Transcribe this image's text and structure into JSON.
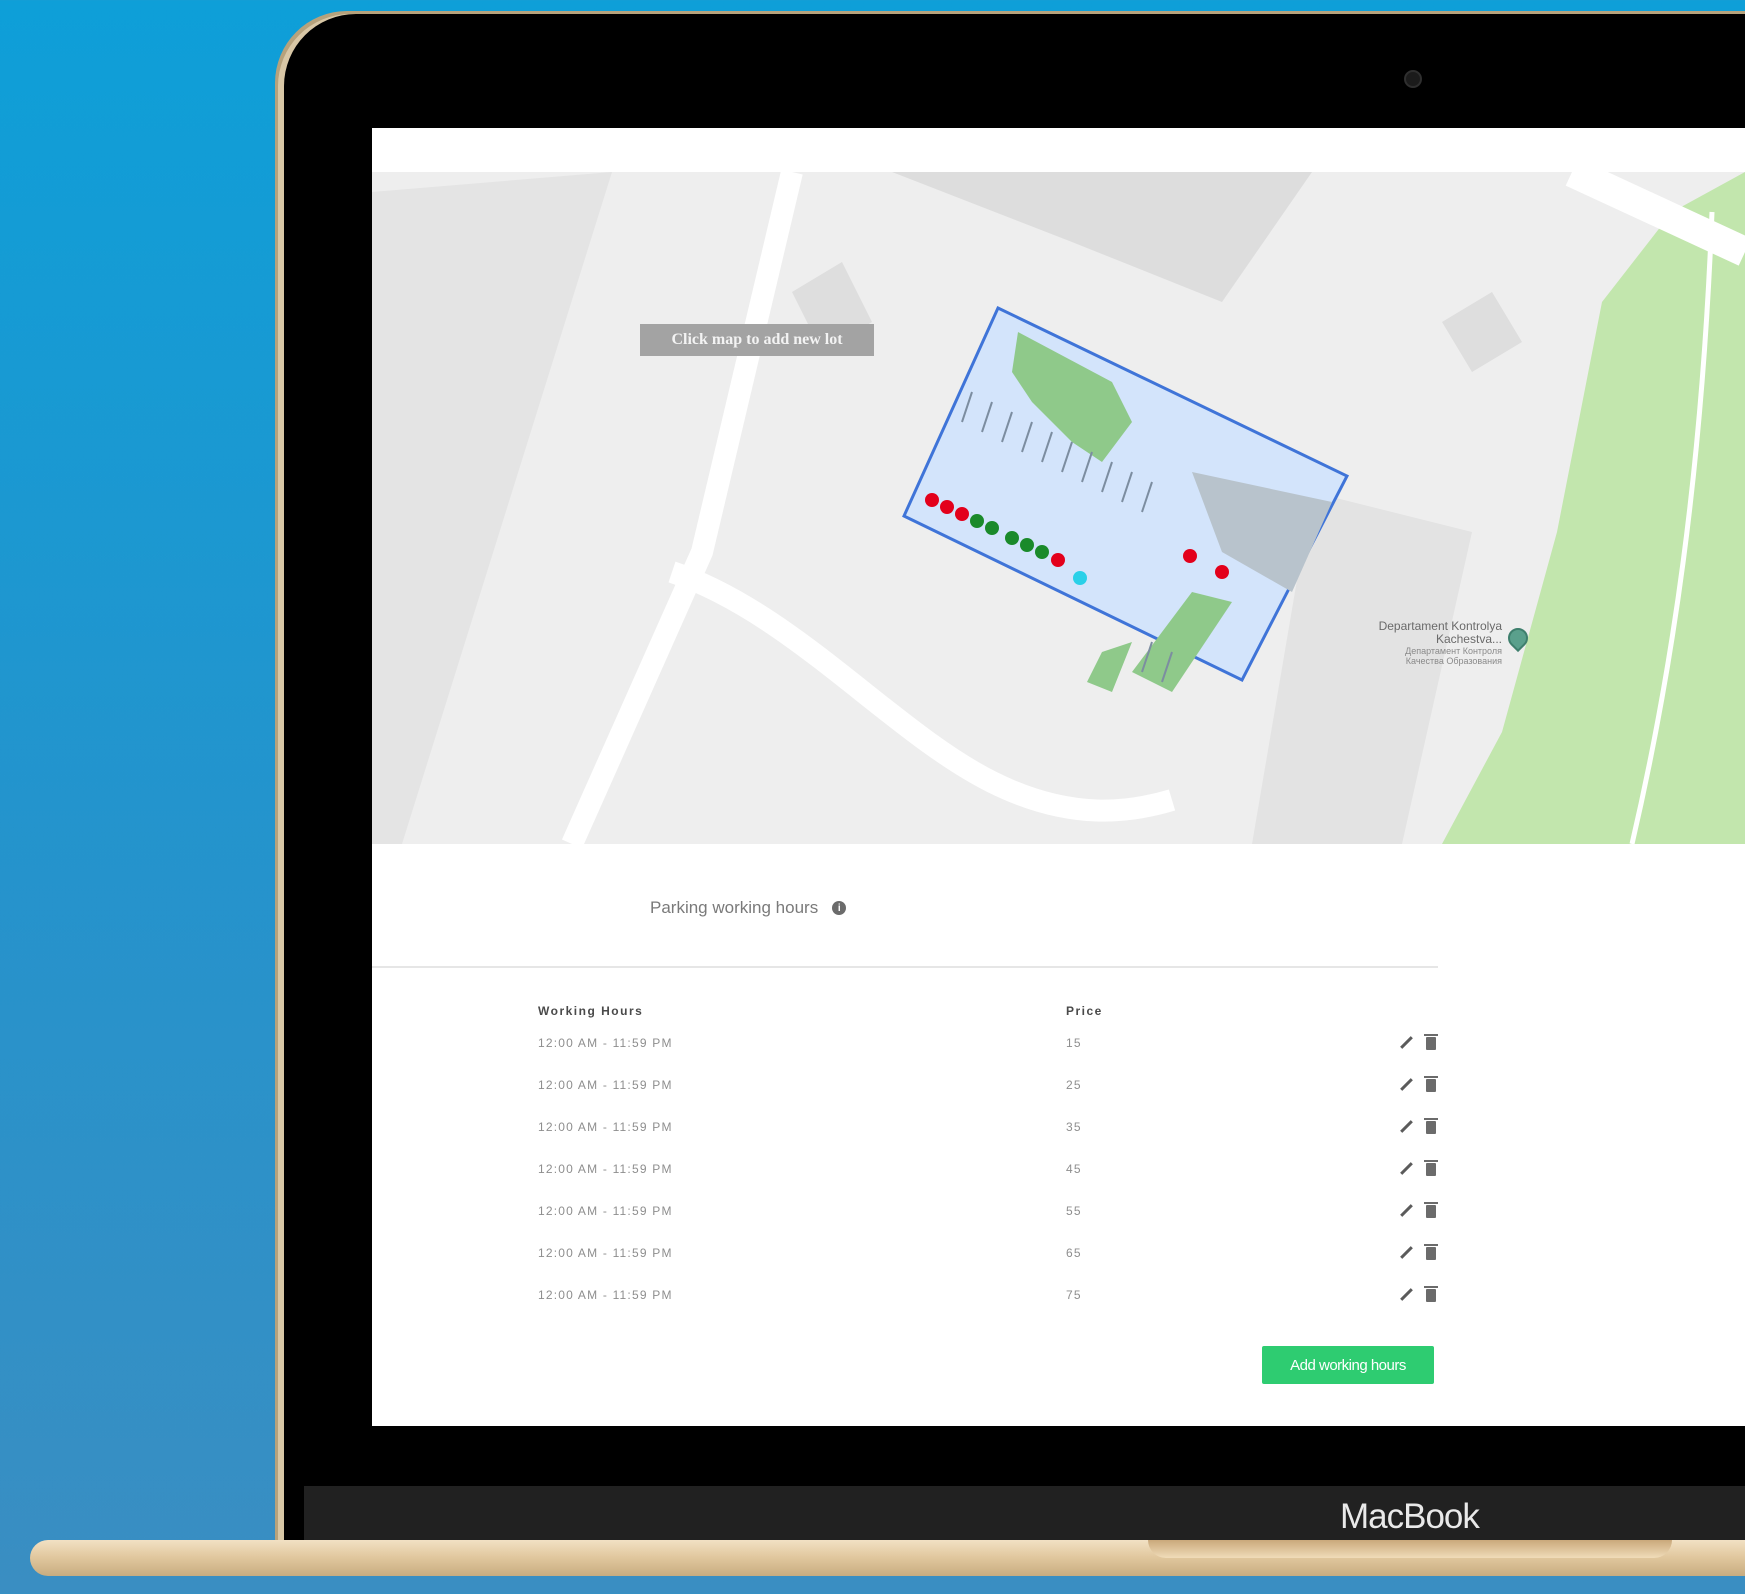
{
  "device": {
    "brand_label": "MacBook"
  },
  "map": {
    "hint": "Click map to add new lot",
    "poi": {
      "name_line1": "Departament Kontrolya",
      "name_line2": "Kachestva...",
      "sub_line1": "Департамент Контроля",
      "sub_line2": "Качества Образования"
    },
    "spot_colors": {
      "occupied": "#e3001b",
      "free": "#1a8a2a",
      "selected": "#2ad0e8"
    }
  },
  "section": {
    "title": "Parking working hours",
    "info_glyph": "i"
  },
  "table": {
    "headers": {
      "hours": "Working Hours",
      "price": "Price"
    },
    "rows": [
      {
        "hours": "12:00 AM - 11:59 PM",
        "price": "15"
      },
      {
        "hours": "12:00 AM - 11:59 PM",
        "price": "25"
      },
      {
        "hours": "12:00 AM - 11:59 PM",
        "price": "35"
      },
      {
        "hours": "12:00 AM - 11:59 PM",
        "price": "45"
      },
      {
        "hours": "12:00 AM - 11:59 PM",
        "price": "55"
      },
      {
        "hours": "12:00 AM - 11:59 PM",
        "price": "65"
      },
      {
        "hours": "12:00 AM - 11:59 PM",
        "price": "75"
      }
    ],
    "row_icons": [
      "pencil-icon",
      "trash-icon"
    ]
  },
  "actions": {
    "add_label": "Add working hours",
    "accent": "#2ecc71"
  }
}
